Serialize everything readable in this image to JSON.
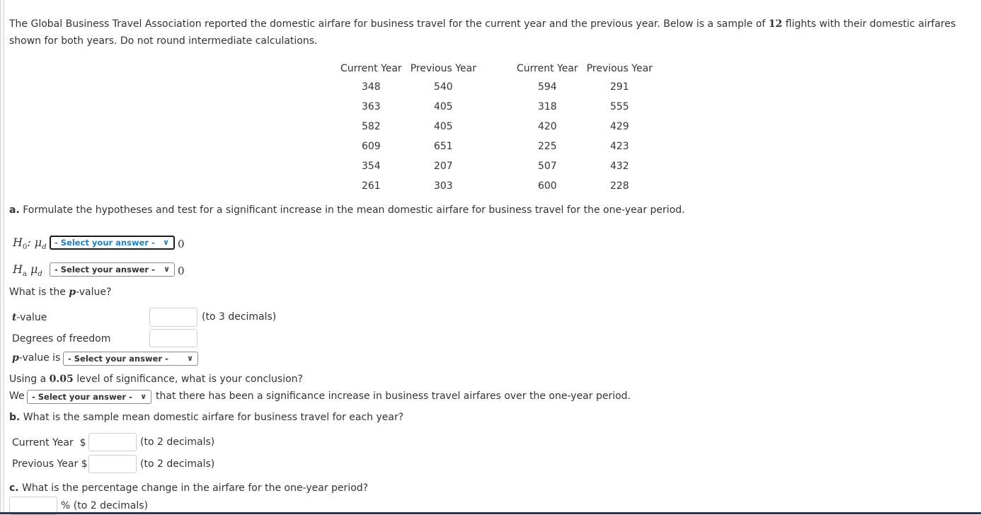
{
  "intro": {
    "part1": "The Global Business Travel Association reported the domestic airfare for business travel for the current year and the previous year. Below is a sample of ",
    "n": "12",
    "part2": " flights with their domestic airfares shown for both years. Do not round intermediate calculations."
  },
  "table": {
    "headers": [
      "Current Year",
      "Previous Year",
      "Current Year",
      "Previous Year"
    ],
    "left_rows": [
      [
        "348",
        "540"
      ],
      [
        "363",
        "405"
      ],
      [
        "582",
        "405"
      ],
      [
        "609",
        "651"
      ],
      [
        "354",
        "207"
      ],
      [
        "261",
        "303"
      ]
    ],
    "right_rows": [
      [
        "594",
        "291"
      ],
      [
        "318",
        "555"
      ],
      [
        "420",
        "429"
      ],
      [
        "225",
        "423"
      ],
      [
        "507",
        "432"
      ],
      [
        "600",
        "228"
      ]
    ]
  },
  "part_a": {
    "label": "a.",
    "question": " Formulate the hypotheses and test for a significant increase in the mean domestic airfare for business travel for the one-year period.",
    "h0_label": "H",
    "h0_sub": "0",
    "h0_mu": ": μ",
    "h0_mu_sub": "d",
    "ha_label": "H",
    "ha_sub": "a",
    "ha_mu": " μ",
    "ha_mu_sub": "d",
    "select_placeholder": "- Select your answer -",
    "zero": "0",
    "pvalue_question_pre": "What is the ",
    "p": "p",
    "pvalue_question_post": "-value?",
    "t_letter": "t",
    "t_label": "-value",
    "t_hint": "(to 3 decimals)",
    "df_label": "Degrees of freedom",
    "p_letter": "p",
    "pvalue_is_label": "-value is",
    "conclusion_pre": "Using a ",
    "alpha": "0.05",
    "conclusion_post": " level of significance, what is your conclusion?",
    "we_label": "We",
    "we_tail": "that there has been a significance increase in business travel airfares over the one-year period."
  },
  "part_b": {
    "label": "b.",
    "question": " What is the sample mean domestic airfare for business travel for each year?",
    "current_label": "Current Year  $",
    "previous_label": "Previous Year $",
    "hint": "(to 2 decimals)"
  },
  "part_c": {
    "label": "c.",
    "question": " What is the percentage change in the airfare for the one-year period?",
    "hint": "% (to 2 decimals)"
  },
  "chevron_glyph": "⌄"
}
